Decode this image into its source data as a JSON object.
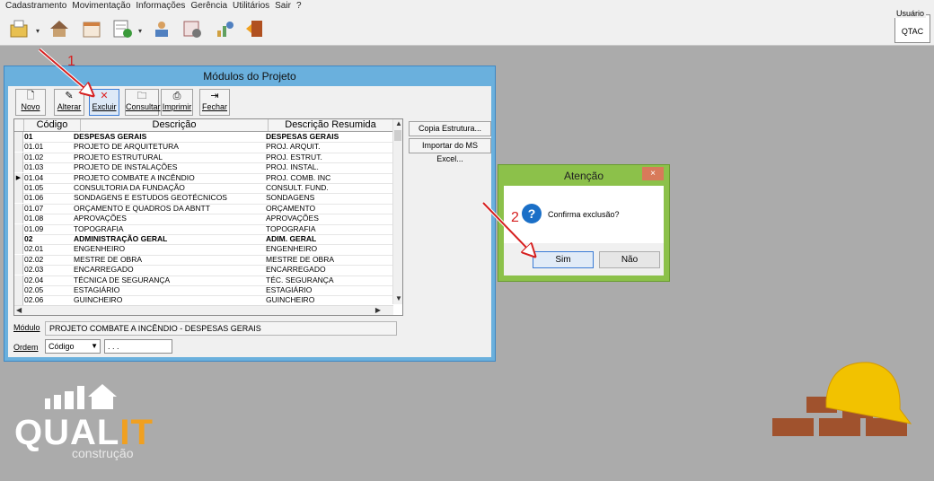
{
  "menu": [
    "Cadastramento",
    "Movimentação",
    "Informações",
    "Gerência",
    "Utilitários",
    "Sair",
    "?"
  ],
  "toolbar_icons": [
    "open-folder-icon",
    "dropdown-arrow",
    "house-icon",
    "calendar-icon",
    "spreadsheet-money-icon",
    "dropdown-arrow",
    "user-report-icon",
    "calendar-clock-icon",
    "chart-user-icon",
    "exit-door-icon"
  ],
  "user": {
    "label": "Usuário",
    "value": "QTAC"
  },
  "window": {
    "title": "Módulos do Projeto",
    "buttons": [
      {
        "label": "Novo",
        "icon": "new-document-icon"
      },
      {
        "label": "Alterar",
        "icon": "pencil-icon"
      },
      {
        "label": "Excluir",
        "icon": "delete-x-icon"
      },
      {
        "label": "Consultar",
        "icon": "folder-search-icon"
      },
      {
        "label": "Imprimir",
        "icon": "printer-icon"
      },
      {
        "label": "Fechar",
        "icon": "exit-icon"
      }
    ],
    "side_buttons": [
      "Copia Estrutura...",
      "Importar do MS Excel..."
    ],
    "columns": [
      "Código",
      "Descrição",
      "Descrição Resumida"
    ],
    "rows": [
      {
        "code": "01",
        "desc": "DESPESAS GERAIS",
        "short": "DESPESAS GERAIS",
        "bold": true
      },
      {
        "code": "01.01",
        "desc": "PROJETO DE ARQUITETURA",
        "short": "PROJ. ARQUIT."
      },
      {
        "code": "01.02",
        "desc": "PROJETO ESTRUTURAL",
        "short": "PROJ. ESTRUT."
      },
      {
        "code": "01.03",
        "desc": "PROJETO DE INSTALAÇÕES",
        "short": "PROJ. INSTAL."
      },
      {
        "code": "01.04",
        "desc": "PROJETO COMBATE A INCÊNDIO",
        "short": "PROJ. COMB. INC",
        "current": true
      },
      {
        "code": "01.05",
        "desc": "CONSULTORIA DA FUNDAÇÃO",
        "short": "CONSULT. FUND."
      },
      {
        "code": "01.06",
        "desc": "SONDAGENS E ESTUDOS GEOTÉCNICOS",
        "short": "SONDAGENS"
      },
      {
        "code": "01.07",
        "desc": "ORÇAMENTO E QUADROS DA ABNTT",
        "short": "ORÇAMENTO"
      },
      {
        "code": "01.08",
        "desc": "APROVAÇÕES",
        "short": "APROVAÇÕES"
      },
      {
        "code": "01.09",
        "desc": "TOPOGRAFIA",
        "short": "TOPOGRAFIA"
      },
      {
        "code": "02",
        "desc": "ADMINISTRAÇÃO GERAL",
        "short": "ADIM. GERAL",
        "bold": true
      },
      {
        "code": "02.01",
        "desc": "ENGENHEIRO",
        "short": "ENGENHEIRO"
      },
      {
        "code": "02.02",
        "desc": "MESTRE DE OBRA",
        "short": "MESTRE DE OBRA"
      },
      {
        "code": "02.03",
        "desc": "ENCARREGADO",
        "short": "ENCARREGADO"
      },
      {
        "code": "02.04",
        "desc": "TÉCNICA DE SEGURANÇA",
        "short": "TÉC. SEGURANÇA"
      },
      {
        "code": "02.05",
        "desc": "ESTAGIÁRIO",
        "short": "ESTAGIÁRIO"
      },
      {
        "code": "02.06",
        "desc": "GUINCHEIRO",
        "short": "GUINCHEIRO"
      }
    ],
    "modulo_label": "Módulo",
    "modulo_value": "PROJETO COMBATE A INCÊNDIO - DESPESAS GERAIS",
    "ordem_label": "Ordem",
    "ordem_value": "Código",
    "ordem_extra": ". . ."
  },
  "dialog": {
    "title": "Atenção",
    "message": "Confirma exclusão?",
    "yes": "Sim",
    "no": "Não",
    "close": "×"
  },
  "annotations": [
    "1",
    "2"
  ],
  "logo": {
    "main": "QUAL",
    "accent": "IT",
    "sub": "construção"
  },
  "colors": {
    "dialog_frame": "#8cc14a",
    "window_frame": "#6ab0dd",
    "arrow": "#d62020",
    "logo_accent": "#f0a020"
  }
}
